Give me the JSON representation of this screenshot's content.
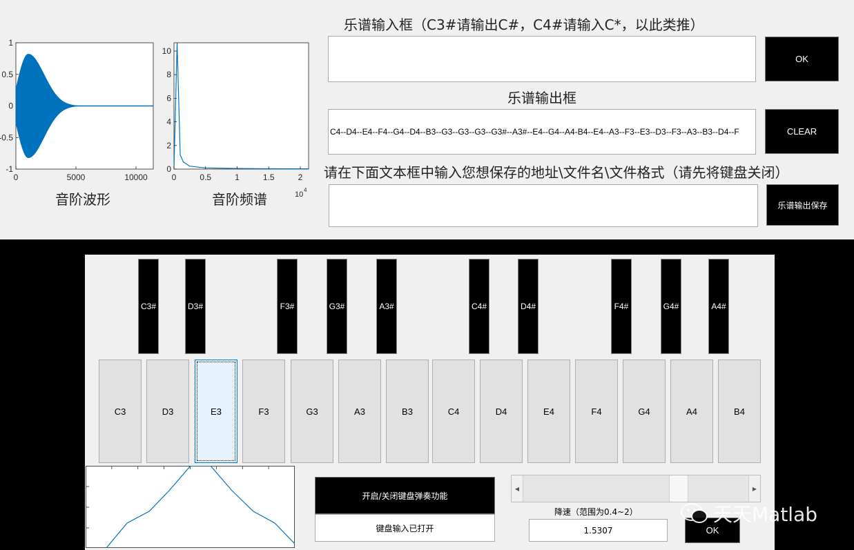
{
  "plots": {
    "waveform": {
      "yticks": [
        "1",
        "0.5",
        "0",
        "-0.5",
        "-1"
      ],
      "xticks": [
        "0",
        "5000",
        "10000"
      ],
      "caption": "音阶波形",
      "color": "#0072bd"
    },
    "spectrum": {
      "yticks": [
        "10",
        "8",
        "6",
        "4",
        "2",
        "0"
      ],
      "xticks": [
        "0",
        "0.5",
        "1",
        "1.5",
        "2"
      ],
      "exponent_base": "10",
      "exponent_power": "4",
      "caption": "音阶频谱",
      "color": "#0072bd"
    },
    "mini": {
      "color": "#0072bd"
    }
  },
  "score_input": {
    "label": "乐谱输入框（C3#请输出C#，C4#请输入C*，以此类推）",
    "value": ""
  },
  "ok_button": {
    "label": "OK"
  },
  "score_output": {
    "label": "乐谱输出框",
    "value": "C4--D4--E4--F4--G4--D4--B3--G3--G3--G3--G3#--A3#--E4--G4--A4-B4--E4--A3--F3--E3--D3--F3--A3--B3--D4--F"
  },
  "clear_button": {
    "label": "CLEAR"
  },
  "save_path": {
    "label": "请在下面文本框中输入您想保存的地址\\文件名\\文件格式（请先将键盘关闭）",
    "value": ""
  },
  "save_button": {
    "label": "乐谱输出保存"
  },
  "keyboard": {
    "white_keys": [
      "C3",
      "D3",
      "E3",
      "F3",
      "G3",
      "A3",
      "B3",
      "C4",
      "D4",
      "E4",
      "F4",
      "G4",
      "A4",
      "B4"
    ],
    "black_keys": [
      "C3#",
      "D3#",
      "F3#",
      "G3#",
      "A3#",
      "C4#",
      "D4#",
      "F4#",
      "G4#",
      "A4#"
    ],
    "focused_key": "E3"
  },
  "keyboard_toggle": {
    "label": "开启/关闭键盘弹奏功能"
  },
  "keyboard_status": {
    "value": "键盘输入已打开"
  },
  "speed": {
    "label": "降速（范围为0.4~2）",
    "value": "1.5307",
    "ok_label": "OK"
  },
  "watermark": {
    "text": "天天Matlab"
  }
}
